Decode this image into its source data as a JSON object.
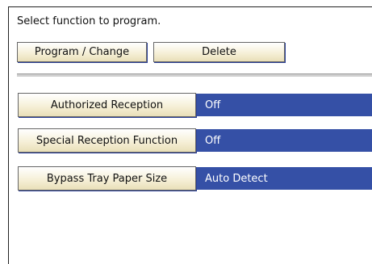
{
  "instruction": "Select function to program.",
  "toolbar": {
    "program_change_label": "Program / Change",
    "delete_label": "Delete"
  },
  "settings": [
    {
      "label": "Authorized Reception",
      "value": "Off"
    },
    {
      "label": "Special Reception Function",
      "value": "Off"
    },
    {
      "label": "Bypass Tray Paper Size",
      "value": "Auto Detect"
    }
  ],
  "colors": {
    "value_bg": "#3550a6",
    "button_face": "#f6f0d8",
    "button_shadow": "#2b3f96"
  }
}
